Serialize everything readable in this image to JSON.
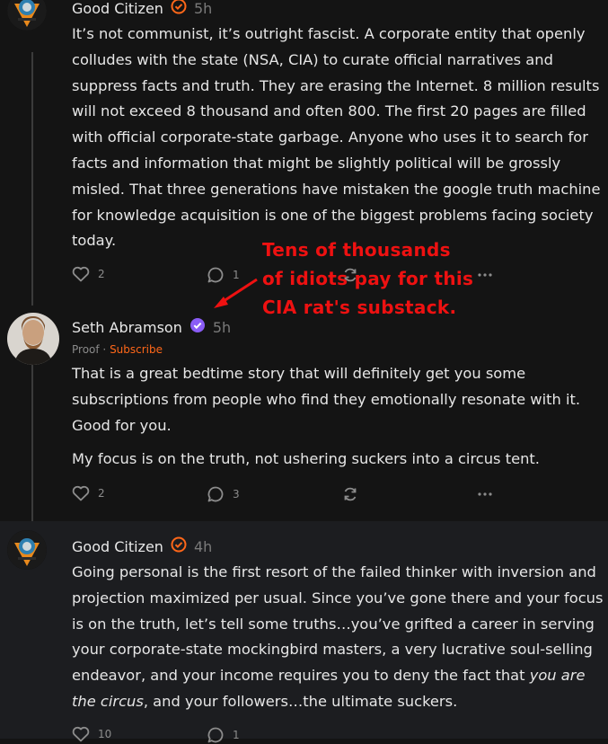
{
  "posts": [
    {
      "author": "Good Citizen",
      "time": "5h",
      "paragraphs": [
        "It’s not communist, it’s outright fascist. A corporate entity that openly colludes with the state (NSA, CIA) to curate official narratives and suppress facts and truth. They are erasing the Internet. 8 million results will not exceed 8 thousand and often 800. The first 20 pages are filled with official corporate-state garbage. Anyone who uses it to search for facts and information that might be slightly political will be grossly misled. That three generations have mistaken the google truth machine for knowledge acquisition is one of the biggest problems facing society today."
      ],
      "likes": "2",
      "comments": "1"
    },
    {
      "author": "Seth Abramson",
      "time": "5h",
      "meta_prefix": "Proof",
      "meta_sep": " · ",
      "meta_subscribe": "Subscribe",
      "paragraphs": [
        "That is a great bedtime story that will definitely get you some subscriptions from people who find they emotionally resonate with it. Good for you.",
        "My focus is on the truth, not ushering suckers into a circus tent."
      ],
      "likes": "2",
      "comments": "3"
    },
    {
      "author": "Good Citizen",
      "time": "4h",
      "text_before_italic": "Going personal is the first resort of the failed thinker with inversion and projection maximized per usual. Since you’ve gone there and your focus is on the truth, let’s tell some truths…you’ve grifted a career in serving your corporate-state mockingbird masters, a very lucrative soul-selling endeavor, and your income requires you to deny the fact that ",
      "italic_text": "you are the circus",
      "text_after_italic": ", and your followers…the ultimate suckers.",
      "likes": "10",
      "comments": "1"
    }
  ],
  "annotation": {
    "lines": [
      "Tens of thousands",
      "of idiots pay for this",
      "CIA rat's substack."
    ],
    "color": "#ee1111"
  },
  "colors": {
    "background": "#141414",
    "highlight_post": "#1c1d20",
    "subscribe": "#ff6719",
    "verified_badge": "#8a5cf6",
    "badge_orange": "#ff6719"
  }
}
